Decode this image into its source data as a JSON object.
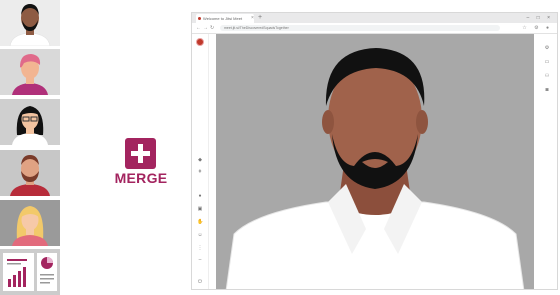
{
  "left_thumbnails": [
    {
      "name": "man with beard",
      "skin": "#8e5b43",
      "hair": "#111111",
      "bg": "#ececec"
    },
    {
      "name": "woman pink hair",
      "skin": "#f2b592",
      "hair": "#e06a8a",
      "bg": "#d9d9d9"
    },
    {
      "name": "woman glasses",
      "skin": "#f2c3a0",
      "hair": "#111111",
      "bg": "#cfcfcf"
    },
    {
      "name": "man red beard",
      "skin": "#e0a283",
      "hair": "#7a3b2a",
      "bg": "#c7c7c7"
    },
    {
      "name": "woman blonde",
      "skin": "#f6c9a8",
      "hair": "#f2c96a",
      "bg": "#9a9a9a"
    },
    {
      "name": "charts document",
      "skin": "",
      "hair": "",
      "bg": "#cccccc"
    }
  ],
  "merge": {
    "label": "MERGE",
    "color": "#a3245f"
  },
  "browser": {
    "tab_title": "Welcome to Jitsi Meet",
    "tab_close": "×",
    "new_tab": "+",
    "window_controls": "– □ ×",
    "back": "←",
    "forward": "→",
    "reload": "↻",
    "url": "meet.jit.si/TheDiscoveredSquadsTogether",
    "address_icons": "☆ ⚙ ●"
  },
  "left_rail_icons": [
    "logo",
    "tag-icon",
    "mic-icon",
    "people-icon",
    "screen-icon",
    "hand-icon",
    "emoji-icon",
    "more-icon",
    "power-icon"
  ],
  "right_rail": [
    "",
    "chat-icon",
    "participants-icon",
    "camera-icon"
  ],
  "video": {
    "bg": "#a8a8a8",
    "skin": "#a0624b",
    "hair": "#111111",
    "shirt": "#ffffff"
  }
}
